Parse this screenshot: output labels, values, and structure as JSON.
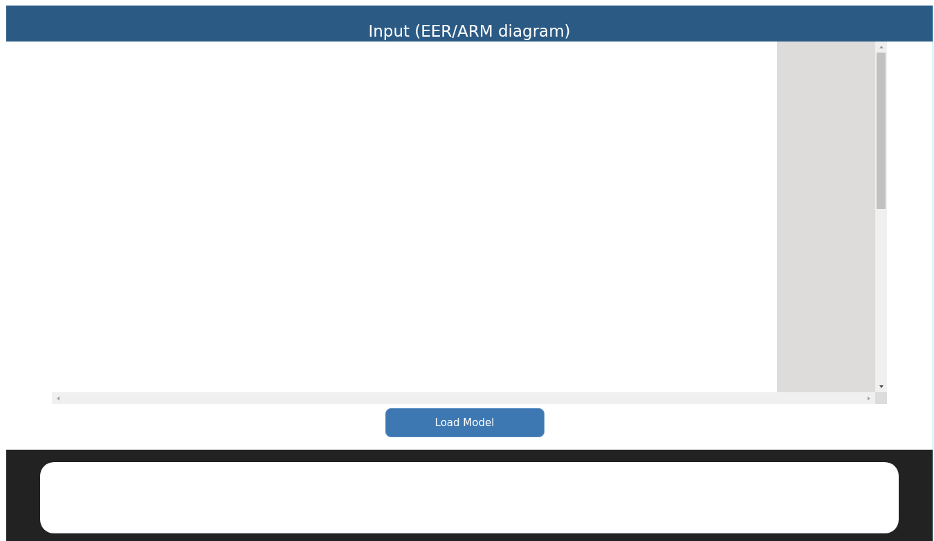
{
  "header": {
    "title": "Input (EER/ARM diagram)"
  },
  "actions": [
    {
      "label": "Load Model"
    }
  ]
}
